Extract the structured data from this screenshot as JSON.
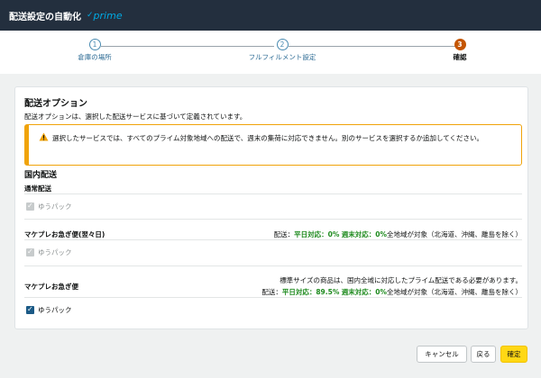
{
  "header": {
    "title": "配送設定の自動化",
    "prime_check": "✓",
    "prime_text": "prime"
  },
  "stepper": {
    "steps": [
      {
        "number": "1",
        "label": "倉庫の場所"
      },
      {
        "number": "2",
        "label": "フルフィルメント設定"
      },
      {
        "number": "3",
        "label": "確認"
      }
    ],
    "current": 3
  },
  "section": {
    "title": "配送オプション",
    "description": "配送オプションは、選択した配送サービスに基づいて定義されています。"
  },
  "alert": {
    "icon": "warning-icon",
    "text": "選択したサービスでは、すべてのプライム対象地域への配送で、週末の集荷に対応できません。別のサービスを選択するか追加してください。"
  },
  "domestic": {
    "title": "国内配送",
    "groups": [
      {
        "title": "通常配送",
        "option": "ゆうパック",
        "checked": true,
        "enabled": false
      },
      {
        "title": "マケプレお急ぎ便(翌々日)",
        "option": "ゆうパック",
        "checked": true,
        "enabled": false,
        "meta_prefix": "配送：",
        "prime_label": "平日対応：0%",
        "weekend_label": "週末対応：0%",
        "coverage": "全地域が対象（北海道、沖縄、離島を除く）"
      },
      {
        "title": "マケプレお急ぎ便",
        "option": "ゆうパック",
        "checked": true,
        "enabled": true,
        "note": "標準サイズの商品は、国内全域に対応したプライム配送である必要があります。",
        "meta_prefix": "配送：",
        "prime_label": "平日対応：89.5%",
        "weekend_label": "週末対応：0%",
        "coverage": "全地域が対象（北海道、沖縄、離島を除く）"
      }
    ]
  },
  "footer": {
    "cancel": "キャンセル",
    "back": "戻る",
    "confirm": "確定"
  },
  "colors": {
    "header_bg": "#232f3e",
    "accent_step": "#c45500",
    "alert_border": "#f0a30a",
    "green": "#1d8a1d",
    "primary_button": "#ffd814"
  }
}
